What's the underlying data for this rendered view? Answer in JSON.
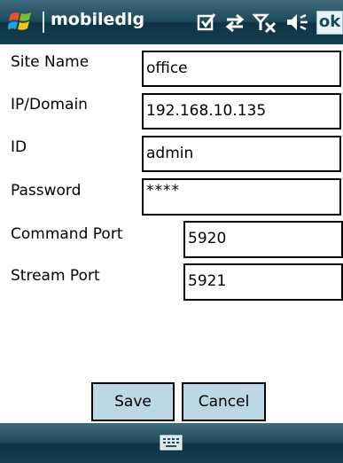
{
  "titlebar": {
    "title": "mobiledlg",
    "ok_label": "ok",
    "icons": [
      "windows-start-icon",
      "checklist-icon",
      "connectivity-icon",
      "signal-off-icon",
      "speaker-icon"
    ]
  },
  "form": {
    "site_name": {
      "label": "Site Name",
      "value": "office"
    },
    "ip_domain": {
      "label": "IP/Domain",
      "value": "192.168.10.135"
    },
    "id": {
      "label": "ID",
      "value": "admin"
    },
    "password": {
      "label": "Password",
      "value": "****"
    },
    "command_port": {
      "label": "Command Port",
      "value": "5920"
    },
    "stream_port": {
      "label": "Stream Port",
      "value": "5921"
    }
  },
  "buttons": {
    "save": "Save",
    "cancel": "Cancel"
  },
  "bottombar": {
    "icon": "keyboard-icon"
  },
  "colors": {
    "titlebar": "#1d4a5c",
    "button_bg": "#bcd7e6",
    "ok_button_bg": "#e8f1f5"
  }
}
